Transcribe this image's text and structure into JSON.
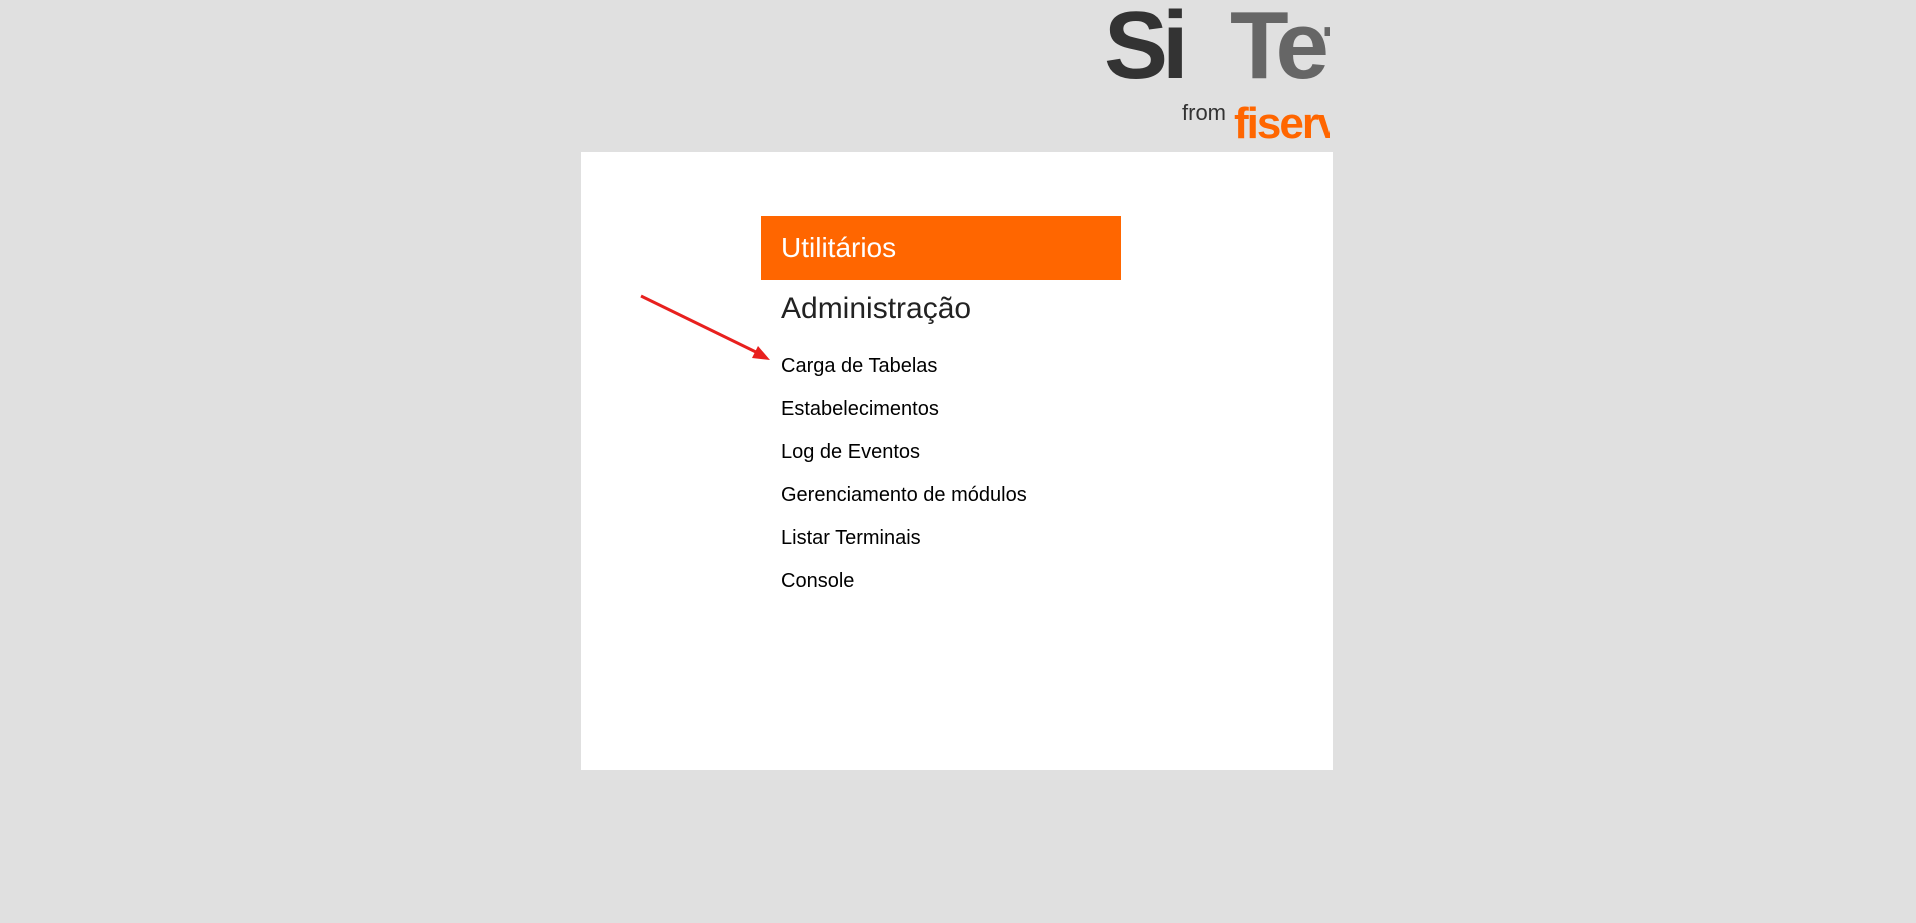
{
  "logo": {
    "brand_si": "Si",
    "brand_tef": "Tef",
    "from_text": "from",
    "fiserv_text": "fiserv.",
    "colors": {
      "si": "#333333",
      "tef": "#666666",
      "fiserv": "#ff6600",
      "from": "#333333"
    }
  },
  "menu": {
    "header_title": "Utilitários",
    "header_color": "#ff6600",
    "section_title": "Administração",
    "items": [
      {
        "label": "Carga de Tabelas"
      },
      {
        "label": "Estabelecimentos"
      },
      {
        "label": "Log de Eventos"
      },
      {
        "label": "Gerenciamento de módulos"
      },
      {
        "label": "Listar Terminais"
      },
      {
        "label": "Console"
      }
    ]
  },
  "annotation": {
    "arrow_color": "#e8201e",
    "points_to": "Carga de Tabelas"
  }
}
